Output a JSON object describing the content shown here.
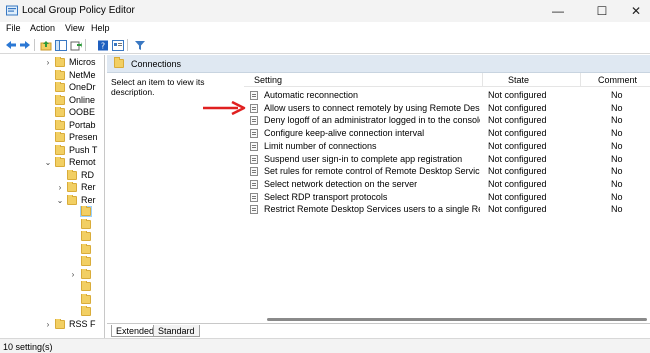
{
  "window": {
    "title": "Local Group Policy Editor",
    "controls": [
      "—",
      "☐",
      "✕"
    ]
  },
  "menu": [
    "File",
    "Action",
    "View",
    "Help"
  ],
  "toolbar": [
    "back-icon",
    "forward-icon",
    "up-folder-icon",
    "console-tree-icon",
    "export-icon",
    "help-icon",
    "properties-icon",
    "filter-icon"
  ],
  "tree": {
    "items": [
      {
        "label": "Micros",
        "expander": "›"
      },
      {
        "label": "NetMe",
        "expander": ""
      },
      {
        "label": "OneDr",
        "expander": ""
      },
      {
        "label": "Online",
        "expander": ""
      },
      {
        "label": "OOBE",
        "expander": ""
      },
      {
        "label": "Portab",
        "expander": ""
      },
      {
        "label": "Presen",
        "expander": ""
      },
      {
        "label": "Push T",
        "expander": ""
      },
      {
        "label": "Remot",
        "expander": "⌄"
      },
      {
        "label": "RD",
        "expander": ""
      },
      {
        "label": "Rer",
        "expander": "›"
      },
      {
        "label": "Rer",
        "expander": "⌄"
      }
    ],
    "cut_label": "RSS F"
  },
  "panel": {
    "header": "Connections",
    "description": "Select an item to view its description.",
    "columns": {
      "setting": "Setting",
      "state": "State",
      "comment": "Comment"
    },
    "rows": [
      {
        "setting": "Automatic reconnection",
        "state": "Not configured",
        "comment": "No"
      },
      {
        "setting": "Allow users to connect remotely by using Remote Desktop S...",
        "state": "Not configured",
        "comment": "No"
      },
      {
        "setting": "Deny logoff of an administrator logged in to the console ses...",
        "state": "Not configured",
        "comment": "No"
      },
      {
        "setting": "Configure keep-alive connection interval",
        "state": "Not configured",
        "comment": "No"
      },
      {
        "setting": "Limit number of connections",
        "state": "Not configured",
        "comment": "No"
      },
      {
        "setting": "Suspend user sign-in to complete app registration",
        "state": "Not configured",
        "comment": "No"
      },
      {
        "setting": "Set rules for remote control of Remote Desktop Services use...",
        "state": "Not configured",
        "comment": "No"
      },
      {
        "setting": "Select network detection on the server",
        "state": "Not configured",
        "comment": "No"
      },
      {
        "setting": "Select RDP transport protocols",
        "state": "Not configured",
        "comment": "No"
      },
      {
        "setting": "Restrict Remote Desktop Services users to a single Remote D...",
        "state": "Not configured",
        "comment": "No"
      }
    ]
  },
  "tabs": [
    "Extended",
    "Standard"
  ],
  "status": "10 setting(s)",
  "colors": {
    "arrow": "#e02020",
    "header_bg": "#dfe8f2",
    "folder": "#f2cf63"
  }
}
